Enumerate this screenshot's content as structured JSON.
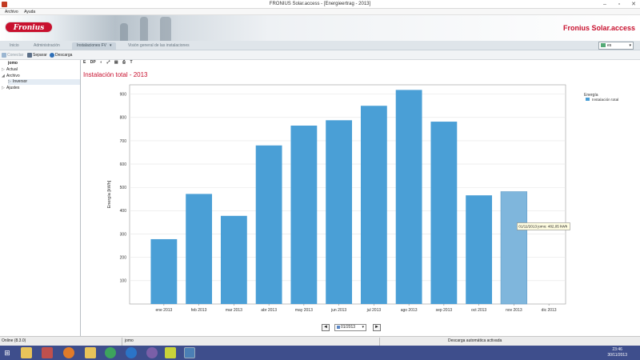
{
  "window": {
    "title": "FRONIUS Solar.access - [Energieertrag - 2013]"
  },
  "menu": [
    "Archivo",
    "Ayuda"
  ],
  "banner": {
    "logo_text": "Fronius",
    "app_name": "Fronius Solar.access"
  },
  "nav_tabs": [
    {
      "label": "Inicio",
      "active": false
    },
    {
      "label": "Administración",
      "active": false
    },
    {
      "label": "Instalaciones FV",
      "active": true
    },
    {
      "label": "Visión general de las instalaciones",
      "active": false
    }
  ],
  "language": {
    "selected": "es"
  },
  "toolbar": {
    "connect": "Conectar",
    "separate": "Separar",
    "download": "Descarga"
  },
  "sidebar": {
    "root": "jomo",
    "items": [
      {
        "label": "Actual",
        "toggle": "▷",
        "level": 0
      },
      {
        "label": "Archivo",
        "toggle": "◢",
        "level": 0
      },
      {
        "label": "Inversor",
        "toggle": "▷",
        "level": 1,
        "selected": true
      },
      {
        "label": "Ajustes",
        "toggle": "▷",
        "level": 0
      }
    ]
  },
  "chart_tools": [
    "E",
    "DP",
    "◐",
    "⤢",
    "▤",
    "⎙",
    "T"
  ],
  "chart_data": {
    "type": "bar",
    "title": "Instalación total - 2013",
    "ylabel": "Energía [kWh]",
    "xlabel": "",
    "ylim": [
      0,
      900
    ],
    "yticks": [
      100,
      200,
      300,
      400,
      500,
      600,
      700,
      800,
      900
    ],
    "grid": true,
    "categories": [
      "ene 2013",
      "feb 2013",
      "mar 2013",
      "abr 2013",
      "may 2013",
      "jun 2013",
      "jul 2013",
      "ago 2013",
      "sep 2013",
      "oct 2013",
      "nov 2013",
      "dic 2013"
    ],
    "series": [
      {
        "name": "Instalación total",
        "values": [
          278,
          472,
          378,
          680,
          765,
          788,
          850,
          918,
          782,
          466,
          482.05,
          null
        ]
      }
    ],
    "highlight_index": 10,
    "legend": {
      "title": "Energía",
      "placement": "top-right"
    },
    "tooltip": "01/11/2013 jomo: 482,05 kWh",
    "bar_color": "#4a9fd6",
    "highlight_color": "#7fb6dc"
  },
  "date_nav": {
    "value": "01/2013",
    "prev": "◄",
    "next": "►"
  },
  "status": {
    "left": "Online (8.3.0)",
    "middle": "jomo",
    "right": "Descarga automática activada"
  },
  "clock": {
    "time": "23:46",
    "date": "30/11/2013"
  },
  "taskbar_icons": [
    "folder-icon",
    "media-icon",
    "firefox-icon",
    "chrome-icon",
    "ie-icon",
    "explorer-icon",
    "tor-icon",
    "yellow-app-icon",
    "solar-access-icon"
  ],
  "colors": {
    "brand_red": "#c8102e",
    "taskbar": "#3e4e8c"
  }
}
